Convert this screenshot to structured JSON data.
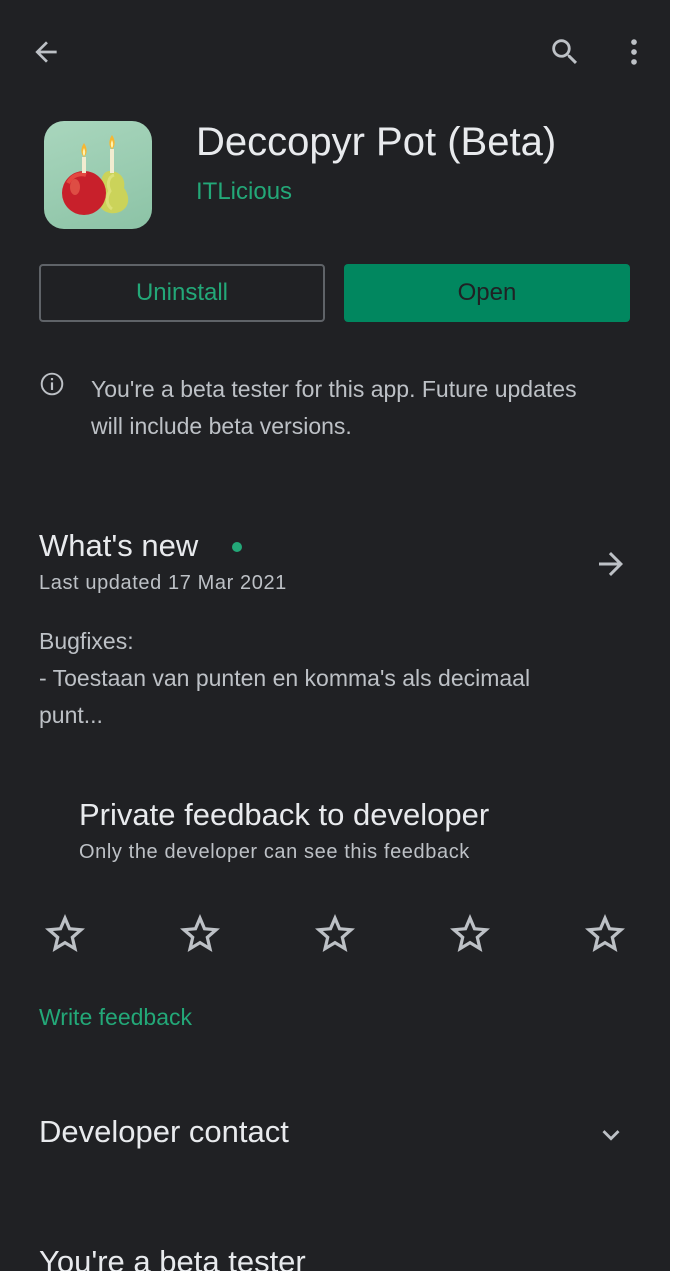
{
  "app": {
    "name": "Deccopyr Pot (Beta)",
    "developer": "ITLicious"
  },
  "actions": {
    "uninstall_label": "Uninstall",
    "open_label": "Open"
  },
  "beta_notice": "You're a beta tester for this app. Future updates will include beta versions.",
  "whats_new": {
    "title": "What's new",
    "last_updated": "Last updated 17 Mar 2021",
    "line1": "Bugfixes:",
    "line2": "- Toestaan van punten en komma's als decimaal punt..."
  },
  "feedback": {
    "title": "Private feedback to developer",
    "subtitle": "Only the developer can see this feedback",
    "star_count": 5,
    "write_label": "Write feedback"
  },
  "developer_contact": {
    "title": "Developer contact"
  },
  "bottom_section": {
    "title": "You're a beta tester"
  },
  "colors": {
    "background": "#202124",
    "accent": "#01875f",
    "accent_text": "#23a878",
    "primary_text": "#e8eaed",
    "secondary_text": "#bdc1c6"
  },
  "icons": {
    "back": "arrow-left",
    "search": "magnifier",
    "more": "three-dots-vertical",
    "info": "info-circle",
    "whats_new_arrow": "arrow-right",
    "star": "star-outline",
    "expand": "chevron-down"
  }
}
